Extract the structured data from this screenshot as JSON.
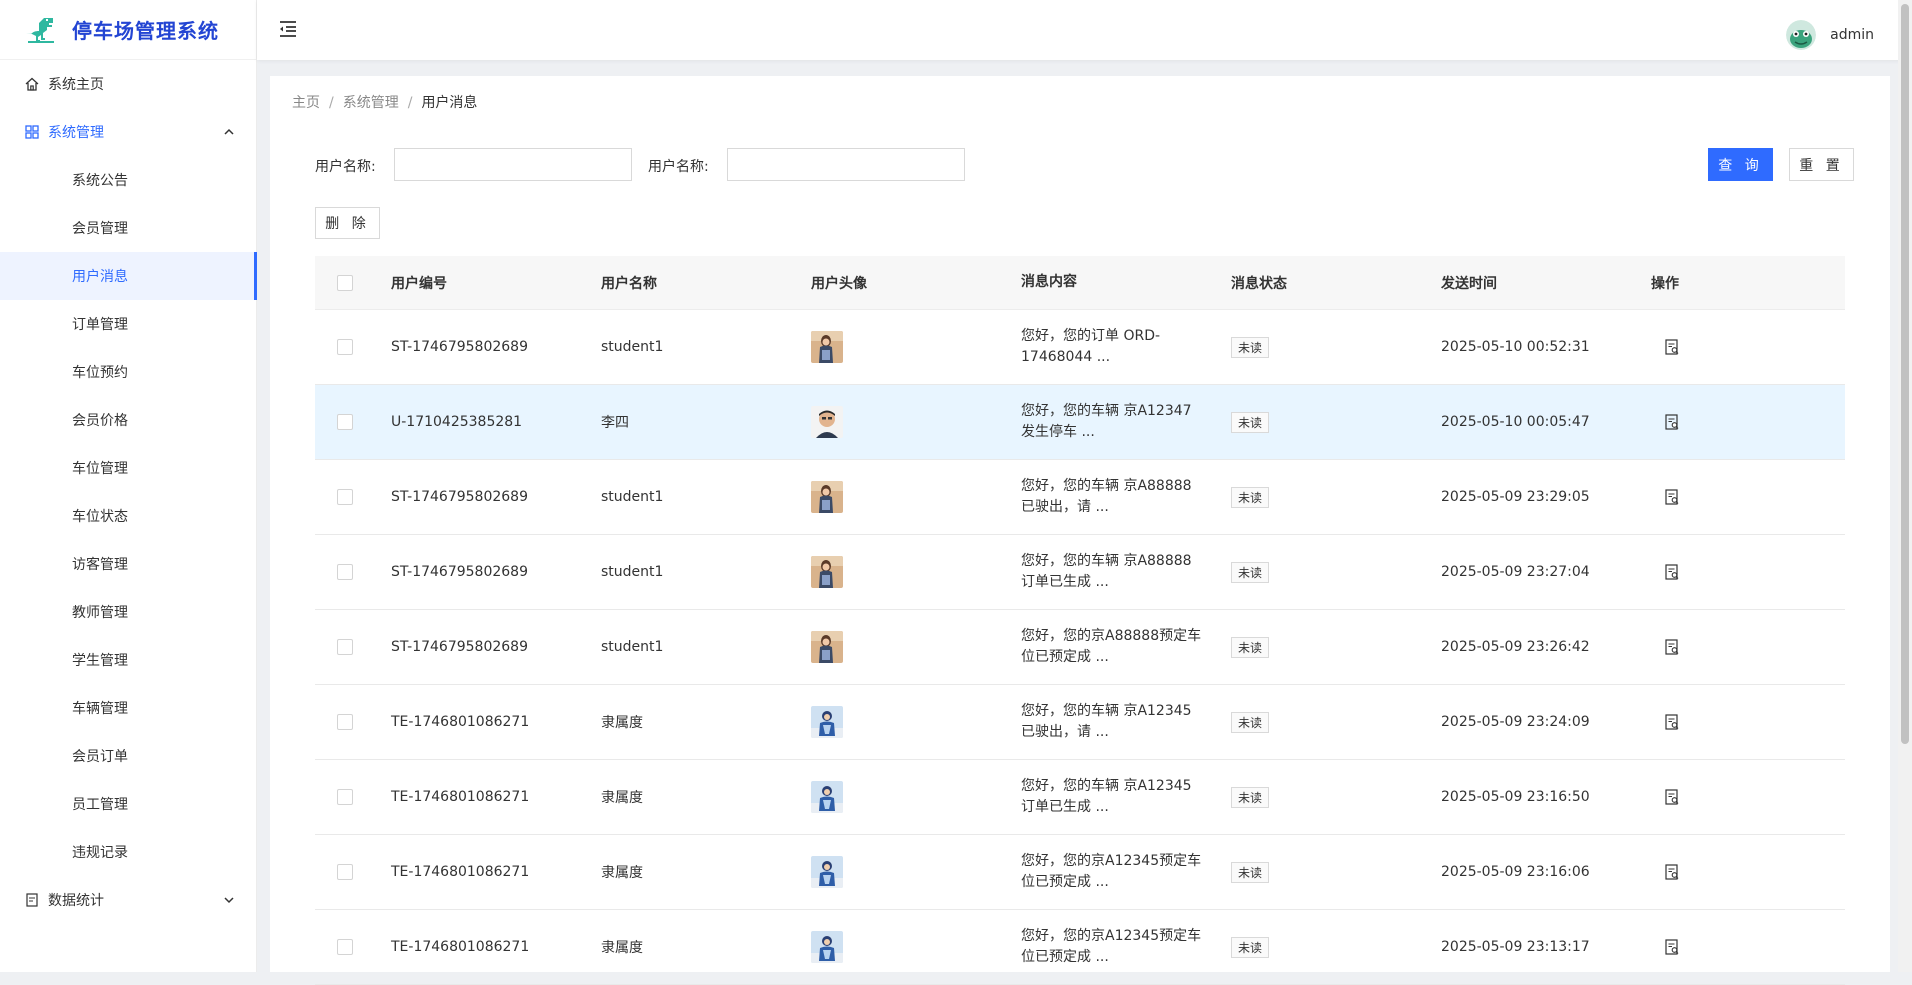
{
  "app": {
    "title": "停车场管理系统"
  },
  "header": {
    "username": "admin"
  },
  "sidebar": {
    "home": "系统主页",
    "group_system": "系统管理",
    "submenu": [
      "系统公告",
      "会员管理",
      "用户消息",
      "订单管理",
      "车位预约",
      "会员价格",
      "车位管理",
      "车位状态",
      "访客管理",
      "教师管理",
      "学生管理",
      "车辆管理",
      "会员订单",
      "员工管理",
      "违规记录"
    ],
    "active_index": 2,
    "group_stats": "数据统计"
  },
  "breadcrumb": [
    "主页",
    "系统管理",
    "用户消息"
  ],
  "search": {
    "label1": "用户名称:",
    "label2": "用户名称:",
    "value1": "",
    "value2": "",
    "query_button": "查 询",
    "reset_button": "重 置"
  },
  "toolbar": {
    "delete_button": "删 除"
  },
  "table": {
    "columns": [
      "用户编号",
      "用户名称",
      "用户头像",
      "消息内容",
      "消息状态",
      "发送时间",
      "操作"
    ],
    "rows": [
      {
        "id": "ST-1746795802689",
        "name": "student1",
        "avatar": "girl",
        "msg1": "您好，您的订单 ORD-",
        "msg2": "17468044 ...",
        "status": "未读",
        "time": "2025-05-10 00:52:31"
      },
      {
        "id": "U-1710425385281",
        "name": "李四",
        "avatar": "man",
        "msg1": "您好，您的车辆 京A12347",
        "msg2": "发生停车 ...",
        "status": "未读",
        "time": "2025-05-10 00:05:47"
      },
      {
        "id": "ST-1746795802689",
        "name": "student1",
        "avatar": "girl",
        "msg1": "您好，您的车辆 京A88888",
        "msg2": "已驶出，请 ...",
        "status": "未读",
        "time": "2025-05-09 23:29:05"
      },
      {
        "id": "ST-1746795802689",
        "name": "student1",
        "avatar": "girl",
        "msg1": "您好，您的车辆 京A88888",
        "msg2": "订单已生成 ...",
        "status": "未读",
        "time": "2025-05-09 23:27:04"
      },
      {
        "id": "ST-1746795802689",
        "name": "student1",
        "avatar": "girl",
        "msg1": "您好，您的京A88888预定车",
        "msg2": "位已预定成 ...",
        "status": "未读",
        "time": "2025-05-09 23:26:42"
      },
      {
        "id": "TE-1746801086271",
        "name": "隶属度",
        "avatar": "blue",
        "msg1": "您好，您的车辆 京A12345",
        "msg2": "已驶出，请 ...",
        "status": "未读",
        "time": "2025-05-09 23:24:09"
      },
      {
        "id": "TE-1746801086271",
        "name": "隶属度",
        "avatar": "blue",
        "msg1": "您好，您的车辆 京A12345",
        "msg2": "订单已生成 ...",
        "status": "未读",
        "time": "2025-05-09 23:16:50"
      },
      {
        "id": "TE-1746801086271",
        "name": "隶属度",
        "avatar": "blue",
        "msg1": "您好，您的京A12345预定车",
        "msg2": "位已预定成 ...",
        "status": "未读",
        "time": "2025-05-09 23:16:06"
      },
      {
        "id": "TE-1746801086271",
        "name": "隶属度",
        "avatar": "blue",
        "msg1": "您好，您的京A12345预定车",
        "msg2": "位已预定成 ...",
        "status": "未读",
        "time": "2025-05-09 23:13:17"
      }
    ]
  },
  "colors": {
    "accent": "#2f6bff",
    "brand": "#2345d3",
    "highlight_row": "#e8f5ff"
  }
}
